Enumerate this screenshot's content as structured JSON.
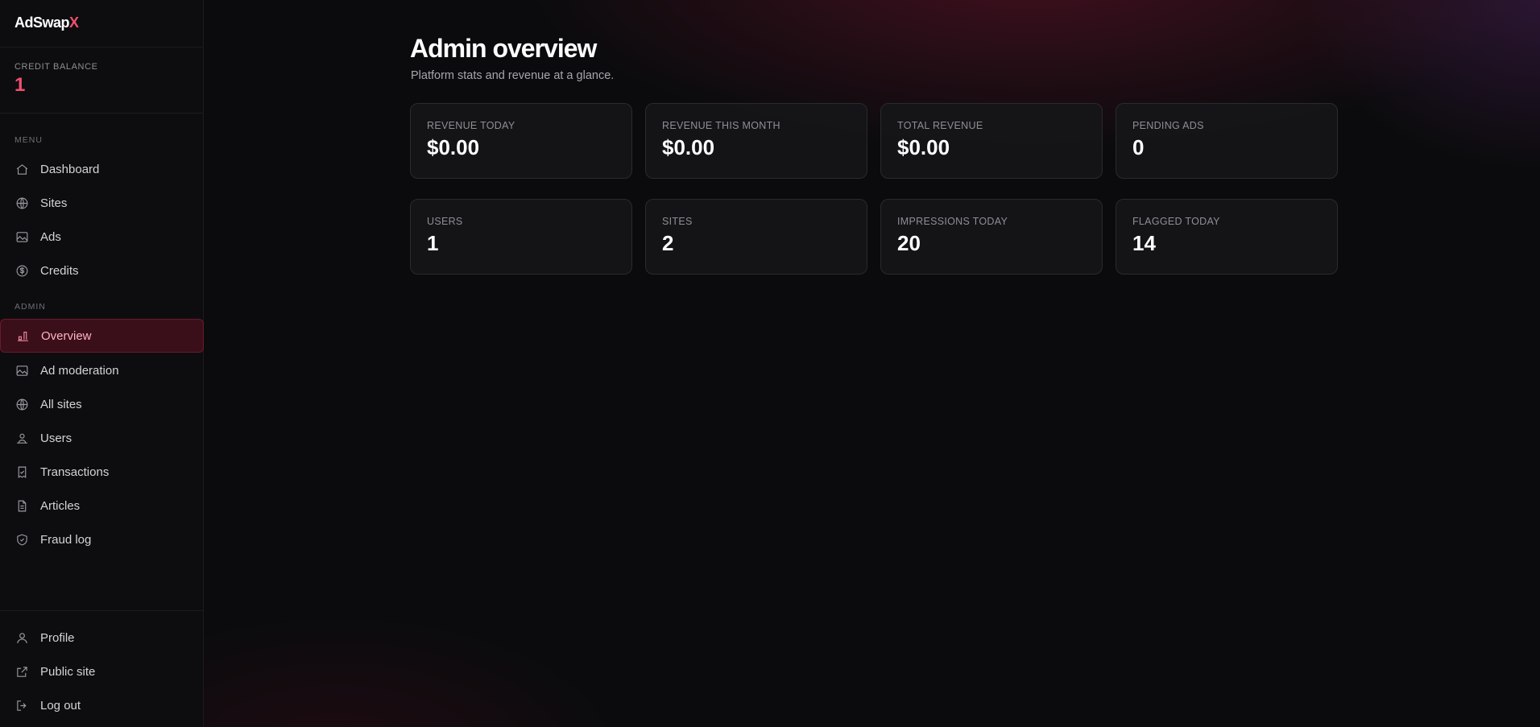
{
  "brand": {
    "name": "AdSwap",
    "accent": "X",
    "accent_color": "#f0506e"
  },
  "credit": {
    "label": "CREDIT BALANCE",
    "value": "1"
  },
  "sidebar": {
    "menu_label": "MENU",
    "menu_items": [
      {
        "label": "Dashboard",
        "icon": "home-icon"
      },
      {
        "label": "Sites",
        "icon": "globe-icon"
      },
      {
        "label": "Ads",
        "icon": "image-icon"
      },
      {
        "label": "Credits",
        "icon": "dollar-circle-icon"
      }
    ],
    "admin_label": "ADMIN",
    "admin_items": [
      {
        "label": "Overview",
        "icon": "chart-icon",
        "active": true
      },
      {
        "label": "Ad moderation",
        "icon": "image-icon"
      },
      {
        "label": "All sites",
        "icon": "globe-icon"
      },
      {
        "label": "Users",
        "icon": "users-icon"
      },
      {
        "label": "Transactions",
        "icon": "receipt-icon"
      },
      {
        "label": "Articles",
        "icon": "document-icon"
      },
      {
        "label": "Fraud log",
        "icon": "shield-check-icon"
      }
    ],
    "bottom_items": [
      {
        "label": "Profile",
        "icon": "user-icon"
      },
      {
        "label": "Public site",
        "icon": "external-link-icon"
      },
      {
        "label": "Log out",
        "icon": "logout-icon"
      }
    ]
  },
  "main": {
    "title": "Admin overview",
    "subtitle": "Platform stats and revenue at a glance.",
    "stats_row1": [
      {
        "label": "REVENUE TODAY",
        "value": "$0.00"
      },
      {
        "label": "REVENUE THIS MONTH",
        "value": "$0.00"
      },
      {
        "label": "TOTAL REVENUE",
        "value": "$0.00"
      },
      {
        "label": "PENDING ADS",
        "value": "0"
      }
    ],
    "stats_row2": [
      {
        "label": "USERS",
        "value": "1"
      },
      {
        "label": "SITES",
        "value": "2"
      },
      {
        "label": "IMPRESSIONS TODAY",
        "value": "20"
      },
      {
        "label": "FLAGGED TODAY",
        "value": "14"
      }
    ]
  },
  "colors": {
    "active_bg": "#3a0f1a",
    "active_text": "#ffb3c1",
    "background": "#0b0b0d"
  }
}
